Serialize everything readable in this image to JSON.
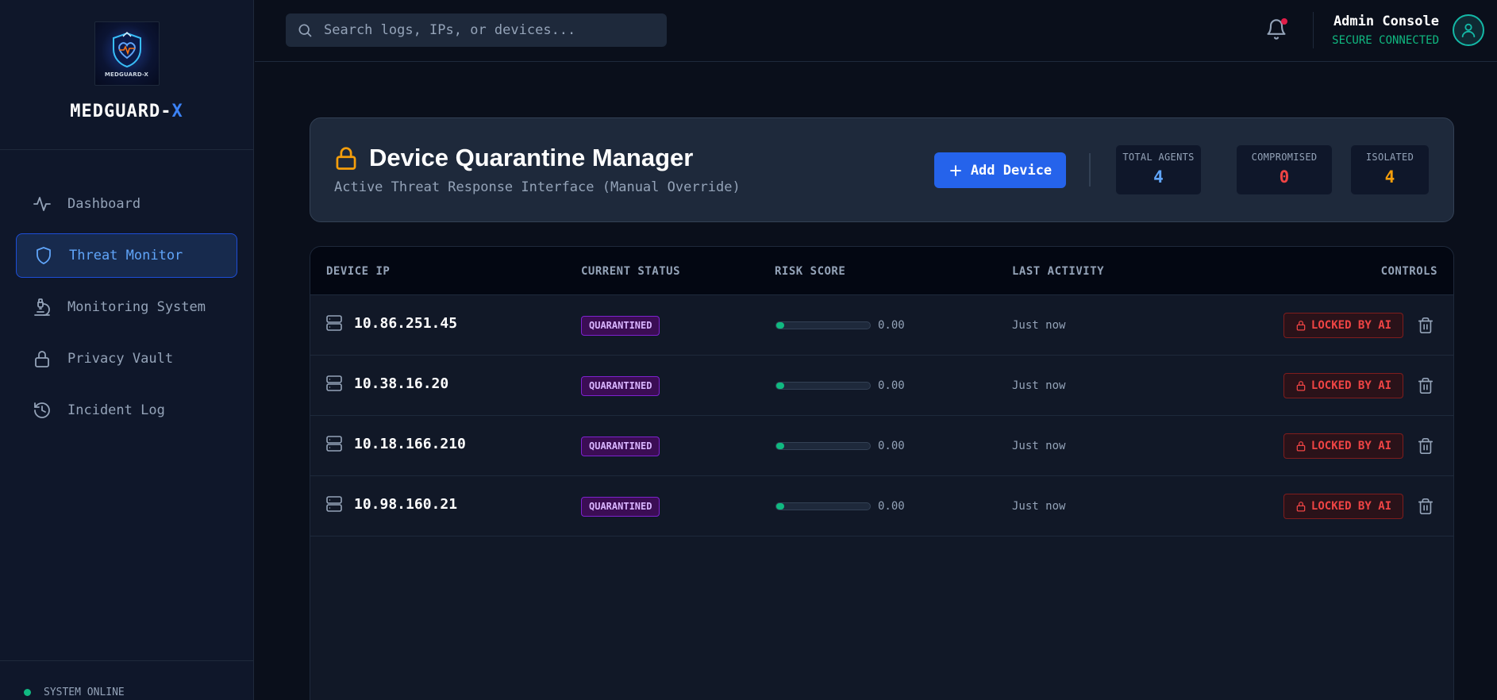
{
  "sidebar": {
    "logo_caption": "MEDGUARD-X",
    "brand_main": "MEDGUARD-",
    "brand_accent": "X",
    "items": [
      {
        "label": "Dashboard",
        "icon": "activity-icon"
      },
      {
        "label": "Threat Monitor",
        "icon": "shield-icon",
        "active": true
      },
      {
        "label": "Monitoring System",
        "icon": "microscope-icon"
      },
      {
        "label": "Privacy Vault",
        "icon": "lock-icon"
      },
      {
        "label": "Incident Log",
        "icon": "history-icon"
      }
    ],
    "status": "SYSTEM ONLINE"
  },
  "header": {
    "search_placeholder": "Search logs, IPs, or devices...",
    "user_name": "Admin Console",
    "connection_status": "SECURE CONNECTED"
  },
  "manager": {
    "title": "Device Quarantine Manager",
    "subtitle": "Active Threat Response Interface (Manual Override)",
    "add_button": "Add Device",
    "stats": [
      {
        "label": "TOTAL AGENTS",
        "value": "4",
        "color": "#60a5fa"
      },
      {
        "label": "COMPROMISED",
        "value": "0",
        "color": "#ef4444"
      },
      {
        "label": "ISOLATED",
        "value": "4",
        "color": "#f59e0b"
      }
    ]
  },
  "table": {
    "columns": [
      "DEVICE IP",
      "CURRENT STATUS",
      "RISK SCORE",
      "LAST ACTIVITY",
      "CONTROLS"
    ],
    "rows": [
      {
        "ip": "10.86.251.45",
        "status": "QUARANTINED",
        "risk": "0.00",
        "activity": "Just now",
        "control": "LOCKED BY AI"
      },
      {
        "ip": "10.38.16.20",
        "status": "QUARANTINED",
        "risk": "0.00",
        "activity": "Just now",
        "control": "LOCKED BY AI"
      },
      {
        "ip": "10.18.166.210",
        "status": "QUARANTINED",
        "risk": "0.00",
        "activity": "Just now",
        "control": "LOCKED BY AI"
      },
      {
        "ip": "10.98.160.21",
        "status": "QUARANTINED",
        "risk": "0.00",
        "activity": "Just now",
        "control": "LOCKED BY AI"
      }
    ]
  },
  "colors": {
    "accent": "#3b82f6",
    "success": "#10b981",
    "danger": "#ef4444",
    "warning": "#f59e0b",
    "quarantine": "#a855f7"
  }
}
